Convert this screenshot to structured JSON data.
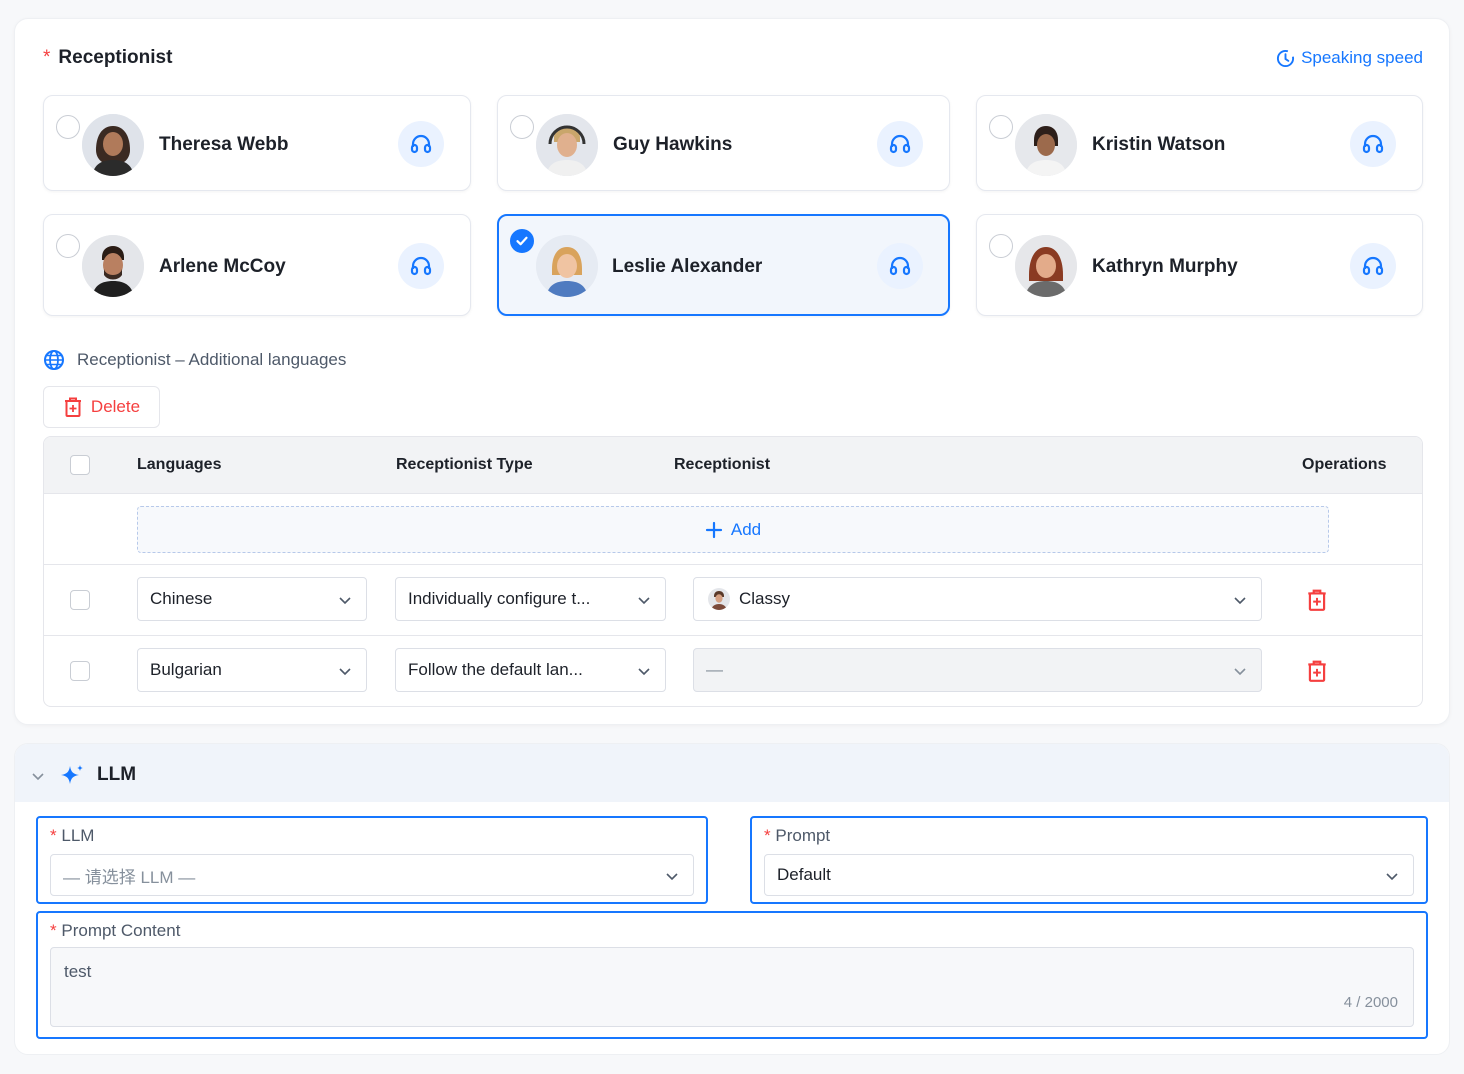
{
  "receptionist_section": {
    "required_mark": "*",
    "title": "Receptionist",
    "speaking_speed_label": "Speaking speed",
    "cards": [
      {
        "name": "Theresa Webb",
        "selected": false
      },
      {
        "name": "Guy Hawkins",
        "selected": false
      },
      {
        "name": "Kristin Watson",
        "selected": false
      },
      {
        "name": "Arlene McCoy",
        "selected": false
      },
      {
        "name": "Leslie Alexander",
        "selected": true
      },
      {
        "name": "Kathryn Murphy",
        "selected": false
      }
    ]
  },
  "additional_languages": {
    "title": "Receptionist – Additional languages",
    "delete_label": "Delete",
    "columns": [
      "Languages",
      "Receptionist Type",
      "Receptionist",
      "Operations"
    ],
    "add_label": "Add",
    "rows": [
      {
        "language": "Chinese",
        "type": "Individually configure t...",
        "receptionist": "Classy"
      },
      {
        "language": "Bulgarian",
        "type": "Follow the default lan...",
        "receptionist": "—"
      }
    ]
  },
  "llm_section": {
    "title": "LLM",
    "llm_field": {
      "required_mark": "*",
      "label": "LLM",
      "placeholder": "— 请选择 LLM —"
    },
    "prompt_field": {
      "required_mark": "*",
      "label": "Prompt",
      "value": "Default"
    },
    "prompt_content": {
      "required_mark": "*",
      "label": "Prompt Content",
      "value": "test",
      "counter": "4 / 2000"
    }
  },
  "colors": {
    "accent": "#1677ff",
    "danger": "#f53f3f",
    "required": "#f53f3f"
  }
}
